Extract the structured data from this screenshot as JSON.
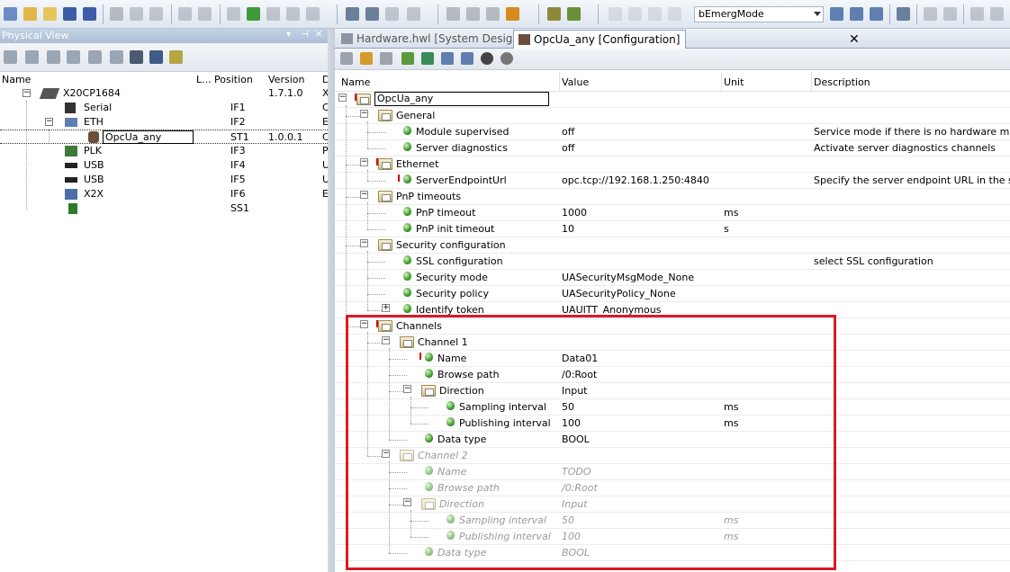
{
  "toolbar": {
    "mode_value": "bEmergMode"
  },
  "left_panel": {
    "title": "Physical View",
    "columns": {
      "name": "Name",
      "l": "L...",
      "position": "Position",
      "version": "Version",
      "d": "D"
    },
    "rows": [
      {
        "name": "X20CP1684",
        "position": "",
        "version": "1.7.1.0",
        "d": "X"
      },
      {
        "name": "Serial",
        "position": "IF1",
        "version": "",
        "d": "C"
      },
      {
        "name": "ETH",
        "position": "IF2",
        "version": "",
        "d": "E"
      },
      {
        "name": "OpcUa_any",
        "position": "ST1",
        "version": "1.0.0.1",
        "d": "C"
      },
      {
        "name": "PLK",
        "position": "IF3",
        "version": "",
        "d": "P"
      },
      {
        "name": "USB",
        "position": "IF4",
        "version": "",
        "d": "U"
      },
      {
        "name": "USB",
        "position": "IF5",
        "version": "",
        "d": "U"
      },
      {
        "name": "X2X",
        "position": "IF6",
        "version": "",
        "d": "E"
      },
      {
        "name": "",
        "position": "SS1",
        "version": "",
        "d": ""
      }
    ]
  },
  "tabs": [
    {
      "label": "Hardware.hwl [System Designer]"
    },
    {
      "label": "OpcUa_any [Configuration]"
    }
  ],
  "grid": {
    "columns": {
      "name": "Name",
      "value": "Value",
      "unit": "Unit",
      "description": "Description"
    },
    "rows": [
      {
        "name": "OpcUa_any",
        "value": "",
        "unit": "",
        "desc": ""
      },
      {
        "name": "General",
        "value": "",
        "unit": "",
        "desc": ""
      },
      {
        "name": "Module supervised",
        "value": "off",
        "unit": "",
        "desc": "Service mode if there is no hardware module"
      },
      {
        "name": "Server diagnostics",
        "value": "off",
        "unit": "",
        "desc": "Activate server diagnostics channels"
      },
      {
        "name": "Ethernet",
        "value": "",
        "unit": "",
        "desc": ""
      },
      {
        "name": "ServerEndpointUrl",
        "value": "opc.tcp://192.168.1.250:4840",
        "unit": "",
        "desc": "Specify the server endpoint URL in the syntax"
      },
      {
        "name": "PnP timeouts",
        "value": "",
        "unit": "",
        "desc": ""
      },
      {
        "name": "PnP timeout",
        "value": "1000",
        "unit": "ms",
        "desc": ""
      },
      {
        "name": "PnP init timeout",
        "value": "10",
        "unit": "s",
        "desc": ""
      },
      {
        "name": "Security configuration",
        "value": "",
        "unit": "",
        "desc": ""
      },
      {
        "name": "SSL configuration",
        "value": "",
        "unit": "",
        "desc": "select SSL configuration"
      },
      {
        "name": "Security mode",
        "value": "UASecurityMsgMode_None",
        "unit": "",
        "desc": ""
      },
      {
        "name": "Security policy",
        "value": "UASecurityPolicy_None",
        "unit": "",
        "desc": ""
      },
      {
        "name": "Identify token",
        "value": "UAUITT_Anonymous",
        "unit": "",
        "desc": ""
      },
      {
        "name": "Channels",
        "value": "",
        "unit": "",
        "desc": ""
      },
      {
        "name": "Channel 1",
        "value": "",
        "unit": "",
        "desc": ""
      },
      {
        "name": "Name",
        "value": "Data01",
        "unit": "",
        "desc": ""
      },
      {
        "name": "Browse path",
        "value": "/0:Root",
        "unit": "",
        "desc": ""
      },
      {
        "name": "Direction",
        "value": "Input",
        "unit": "",
        "desc": ""
      },
      {
        "name": "Sampling interval",
        "value": "50",
        "unit": "ms",
        "desc": ""
      },
      {
        "name": "Publishing interval",
        "value": "100",
        "unit": "ms",
        "desc": ""
      },
      {
        "name": "Data type",
        "value": "BOOL",
        "unit": "",
        "desc": ""
      },
      {
        "name": "Channel 2",
        "value": "",
        "unit": "",
        "desc": ""
      },
      {
        "name": "Name",
        "value": "TODO",
        "unit": "",
        "desc": ""
      },
      {
        "name": "Browse path",
        "value": "/0:Root",
        "unit": "",
        "desc": ""
      },
      {
        "name": "Direction",
        "value": "Input",
        "unit": "",
        "desc": ""
      },
      {
        "name": "Sampling interval",
        "value": "50",
        "unit": "ms",
        "desc": ""
      },
      {
        "name": "Publishing interval",
        "value": "100",
        "unit": "ms",
        "desc": ""
      },
      {
        "name": "Data type",
        "value": "BOOL",
        "unit": "",
        "desc": ""
      }
    ]
  },
  "colors": {
    "highlight": "#d81c26",
    "accent": "#3d9c2a"
  }
}
